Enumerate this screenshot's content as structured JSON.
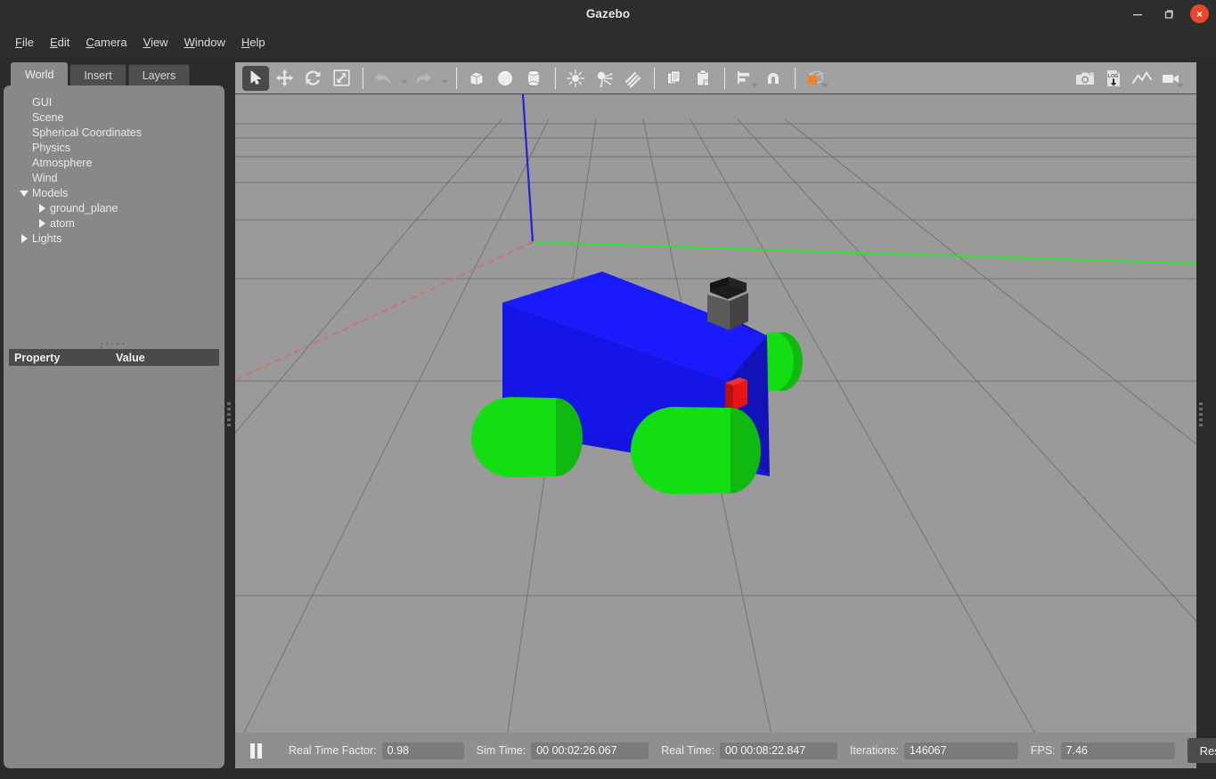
{
  "window": {
    "title": "Gazebo",
    "minimize_label": "minimize",
    "maximize_label": "maximize",
    "close_label": "×"
  },
  "menubar": {
    "items": [
      {
        "label": "File",
        "mnemonic": "F",
        "rest": "ile"
      },
      {
        "label": "Edit",
        "mnemonic": "E",
        "rest": "dit"
      },
      {
        "label": "Camera",
        "mnemonic": "C",
        "rest": "amera"
      },
      {
        "label": "View",
        "mnemonic": "V",
        "rest": "iew"
      },
      {
        "label": "Window",
        "mnemonic": "W",
        "rest": "indow"
      },
      {
        "label": "Help",
        "mnemonic": "H",
        "rest": "elp"
      }
    ]
  },
  "left_panel": {
    "tabs": [
      {
        "label": "World",
        "active": true
      },
      {
        "label": "Insert",
        "active": false
      },
      {
        "label": "Layers",
        "active": false
      }
    ],
    "tree": [
      {
        "label": "GUI",
        "depth": 0,
        "arrow": "none"
      },
      {
        "label": "Scene",
        "depth": 0,
        "arrow": "none"
      },
      {
        "label": "Spherical Coordinates",
        "depth": 0,
        "arrow": "none"
      },
      {
        "label": "Physics",
        "depth": 0,
        "arrow": "none"
      },
      {
        "label": "Atmosphere",
        "depth": 0,
        "arrow": "none"
      },
      {
        "label": "Wind",
        "depth": 0,
        "arrow": "none"
      },
      {
        "label": "Models",
        "depth": 0,
        "arrow": "expanded"
      },
      {
        "label": "ground_plane",
        "depth": 1,
        "arrow": "collapsed"
      },
      {
        "label": "atom",
        "depth": 1,
        "arrow": "collapsed"
      },
      {
        "label": "Lights",
        "depth": 0,
        "arrow": "collapsed"
      }
    ],
    "property_table": {
      "col_property": "Property",
      "col_value": "Value",
      "rows": []
    }
  },
  "toolbar": {
    "left_groups": [
      {
        "name": "select-icon",
        "active": true
      },
      {
        "name": "translate-icon",
        "active": false
      },
      {
        "name": "rotate-icon",
        "active": false
      },
      {
        "name": "scale-icon",
        "active": false
      },
      {
        "name": "undo-icon",
        "active": false
      },
      {
        "name": "redo-icon",
        "active": false
      },
      {
        "name": "box-icon",
        "active": false
      },
      {
        "name": "sphere-icon",
        "active": false
      },
      {
        "name": "cylinder-icon",
        "active": false
      },
      {
        "name": "point-light-icon",
        "active": false
      },
      {
        "name": "spot-light-icon",
        "active": false
      },
      {
        "name": "directional-light-icon",
        "active": false
      },
      {
        "name": "copy-icon",
        "active": false
      },
      {
        "name": "paste-icon",
        "active": false
      },
      {
        "name": "align-icon",
        "active": false
      },
      {
        "name": "snap-icon",
        "active": false
      },
      {
        "name": "view-angle-icon",
        "active": false
      }
    ],
    "right_groups": [
      {
        "name": "screenshot-icon"
      },
      {
        "name": "log-record-icon",
        "label": "LOG"
      },
      {
        "name": "plot-icon"
      },
      {
        "name": "video-record-icon"
      }
    ]
  },
  "status": {
    "pause_label": "pause",
    "real_time_factor_label": "Real Time Factor:",
    "real_time_factor_value": "0.98",
    "sim_time_label": "Sim Time:",
    "sim_time_value": "00 00:02:26.067",
    "real_time_label": "Real Time:",
    "real_time_value": "00 00:08:22.847",
    "iterations_label": "Iterations:",
    "iterations_value": "146067",
    "fps_label": "FPS:",
    "fps_value": "7.46",
    "reset_button": "Reset Time"
  },
  "scene": {
    "description": "Gazebo 3D viewport with gray ground plane grid, world origin axes and a four-wheeled mobile robot model",
    "ground_color": "#9a9a9a",
    "grid_color": "#6f6f6f",
    "axis_x_color": "#d36d6d",
    "axis_y_color": "#36d436",
    "axis_z_color": "#2222dd",
    "robot": {
      "chassis_top_color": "#1a1aff",
      "chassis_front_color": "#1414e0",
      "chassis_side_color": "#1212b8",
      "wheel_color": "#13dd13",
      "wheel_side_color": "#0fb90f",
      "sensor_top_color": "#141414",
      "sensor_body_color": "#5a5a5a",
      "marker_color": "#e81414"
    }
  }
}
